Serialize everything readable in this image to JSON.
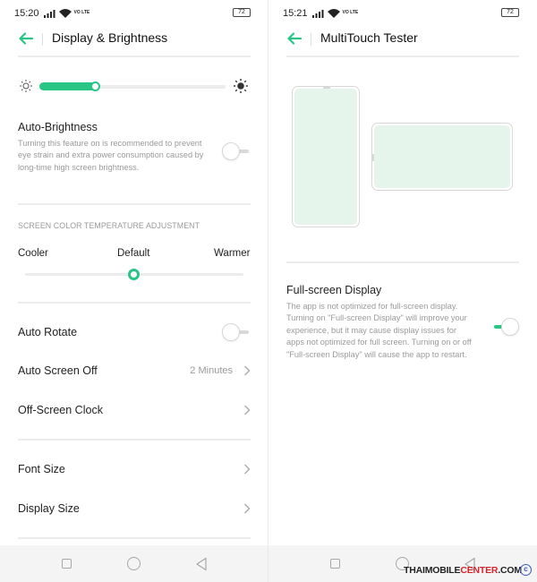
{
  "colors": {
    "accent": "#28c586",
    "text": "#222222",
    "muted": "#9a9a9a",
    "divider": "#ececec"
  },
  "left": {
    "status": {
      "time": "15:20",
      "network_label": "VO LTE",
      "battery": "72"
    },
    "header": {
      "title": "Display & Brightness",
      "back_icon": "back-arrow-icon"
    },
    "brightness": {
      "level_percent": 29
    },
    "auto_brightness": {
      "title": "Auto-Brightness",
      "description": "Turning this feature on is recommended to prevent eye strain and extra power consumption caused by long-time high screen brightness.",
      "enabled": false
    },
    "color_temperature": {
      "section_title": "SCREEN COLOR TEMPERATURE ADJUSTMENT",
      "cooler": "Cooler",
      "default": "Default",
      "warmer": "Warmer"
    },
    "auto_rotate": {
      "title": "Auto Rotate",
      "enabled": false
    },
    "auto_screen_off": {
      "title": "Auto Screen Off",
      "value": "2 Minutes"
    },
    "off_screen_clock": {
      "title": "Off-Screen Clock"
    },
    "font_size": {
      "title": "Font Size"
    },
    "display_size": {
      "title": "Display Size"
    }
  },
  "right": {
    "status": {
      "time": "15:21",
      "network_label": "VO LTE",
      "battery": "72"
    },
    "header": {
      "title": "MultiTouch Tester",
      "back_icon": "back-arrow-icon"
    },
    "full_screen": {
      "title": "Full-screen Display",
      "description": "The app is not optimized for full-screen display. Turning on \"Full-screen Display\" will improve your experience, but it may cause display issues for apps not optimized for full screen. Turning on or off \"Full-screen Display\" will cause the app to restart.",
      "enabled": true
    }
  },
  "watermark": {
    "brand_main": "THAIMOBILE",
    "brand_accent": "CENTER",
    "suffix": ".COM"
  }
}
